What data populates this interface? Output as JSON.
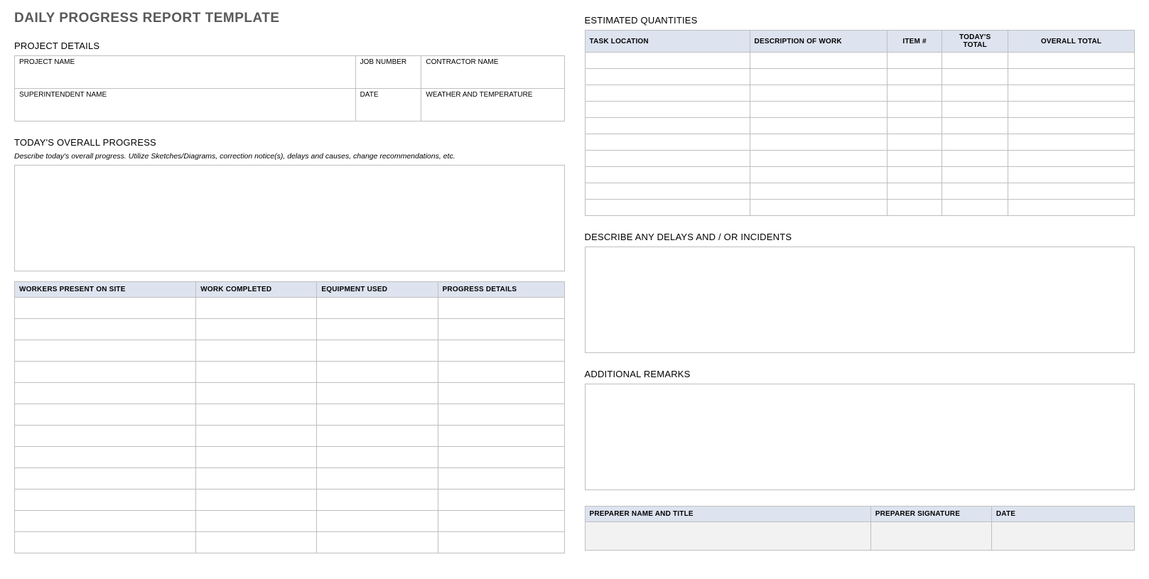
{
  "doc_title": "DAILY PROGRESS REPORT TEMPLATE",
  "left": {
    "project_details": {
      "title": "PROJECT DETAILS",
      "fields": {
        "project_name": "PROJECT NAME",
        "job_number": "JOB NUMBER",
        "contractor_name": "CONTRACTOR NAME",
        "superintendent_name": "SUPERINTENDENT NAME",
        "date": "DATE",
        "weather_temp": "WEATHER AND TEMPERATURE"
      }
    },
    "overall_progress": {
      "title": "TODAY'S OVERALL PROGRESS",
      "instructions": "Describe today's overall progress.  Utilize Sketches/Diagrams, correction notice(s), delays and causes, change recommendations, etc."
    },
    "progress_table": {
      "headers": {
        "workers": "WORKERS PRESENT ON SITE",
        "work": "WORK COMPLETED",
        "equipment": "EQUIPMENT USED",
        "details": "PROGRESS DETAILS"
      },
      "row_count": 12
    }
  },
  "right": {
    "estimated_quantities": {
      "title": "ESTIMATED QUANTITIES",
      "headers": {
        "task_location": "TASK LOCATION",
        "description": "DESCRIPTION OF WORK",
        "item_no": "ITEM #",
        "todays_total": "TODAY'S TOTAL",
        "overall_total": "OVERALL TOTAL"
      },
      "row_count": 10
    },
    "delays": {
      "title": "DESCRIBE ANY DELAYS AND / OR INCIDENTS"
    },
    "remarks": {
      "title": "ADDITIONAL REMARKS"
    },
    "signoff": {
      "headers": {
        "preparer_name": "PREPARER NAME AND TITLE",
        "preparer_sig": "PREPARER SIGNATURE",
        "date": "DATE"
      }
    }
  }
}
